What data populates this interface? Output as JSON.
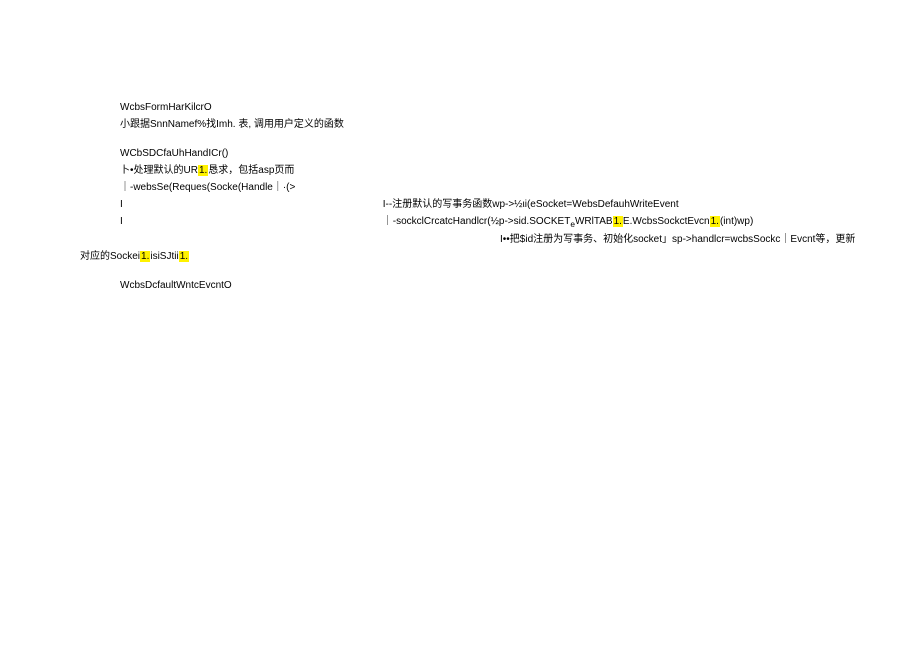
{
  "lines": {
    "l1": "WcbsFormHarKilcrO",
    "l1a": "小跟据SnnNamef%找Imh. 表, 调用用户定义的函数",
    "l2": "WCbSDCfaUhHandICr()",
    "l2a": "卜•处理默认的UR",
    "l2a_hl": "1.",
    "l2a_end": "恳求，包括asp页而",
    "l2b": "｜-websSe(Reques(Socke(Handle｜·(>",
    "l2c": "I",
    "l2c_right": "I--注册默认的写事务函数wp->½ιi(eSocket=WebsDefauhWriteEvent",
    "l2d": "I",
    "l2d_right_a": "｜-sockclCrcatcHandlcr(½p->sid.SOCKET",
    "l2d_right_sub": "e",
    "l2d_right_b": "WRlTAB",
    "l2d_right_hl1": "1.",
    "l2d_right_c": "E.WcbsSockctEvcn",
    "l2d_right_hl2": "1.",
    "l2d_right_d": "(int)wp)",
    "l2e_right": "I••把$id注册为写事务、初始化socket」sp->handlcr=wcbsSockc｜Evcnt等，更新",
    "l2f": "对应的Sockei",
    "l2f_hl1": "1.",
    "l2f_mid": "isiSJtii",
    "l2f_hl2": "1.",
    "l3": "WcbsDcfaultWntcEvcntO"
  }
}
